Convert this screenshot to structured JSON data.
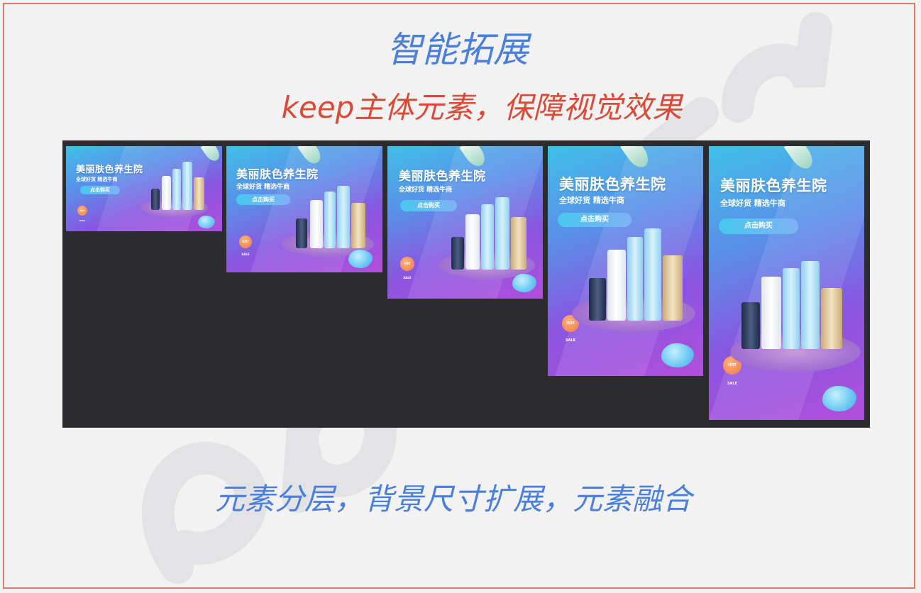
{
  "header": {
    "title": "智能拓展",
    "subtitle": "keep主体元素，保障视觉效果"
  },
  "footer": {
    "caption": "元素分层，背景尺寸扩展，元素融合"
  },
  "banner": {
    "title": "美丽肤色养生院",
    "tagline": "全球好货 精选牛商",
    "button_label": "点击购买",
    "sale_badge": "HOT SALE"
  },
  "colors": {
    "title_blue": "#4a7fdc",
    "subtitle_red": "#db4a36",
    "frame_red": "#e0786a",
    "panel_dark": "#2c2c2e"
  }
}
